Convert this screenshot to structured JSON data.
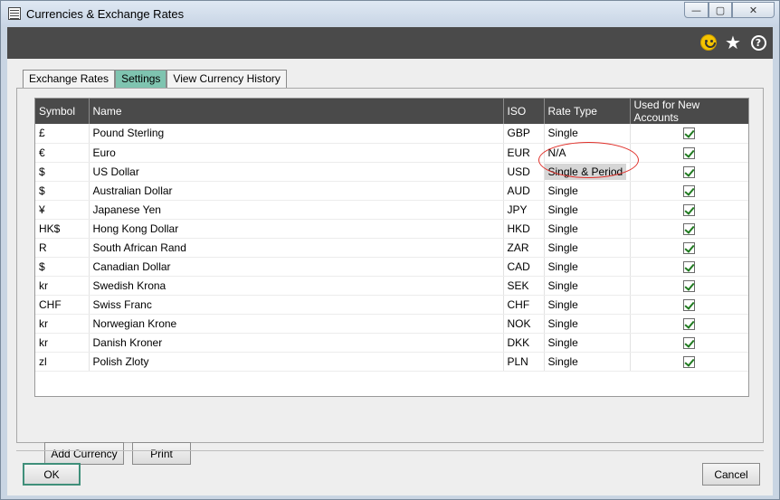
{
  "window": {
    "title": "Currencies & Exchange Rates",
    "minimize_glyph": "—",
    "maximize_glyph": "▢",
    "close_glyph": "✕"
  },
  "toolbar": {
    "icons": [
      "smiley-icon",
      "star-icon",
      "help-icon"
    ],
    "star_glyph": "★",
    "help_glyph": "?"
  },
  "tabs": [
    {
      "label": "Exchange Rates",
      "active": false
    },
    {
      "label": "Settings",
      "active": true
    },
    {
      "label": "View Currency History",
      "active": false
    }
  ],
  "grid": {
    "columns": [
      "Symbol",
      "Name",
      "ISO",
      "Rate Type",
      "Used for New Accounts"
    ],
    "rows": [
      {
        "symbol": "£",
        "name": "Pound Sterling",
        "iso": "GBP",
        "rate_type": "Single",
        "used": true
      },
      {
        "symbol": "€",
        "name": "Euro",
        "iso": "EUR",
        "rate_type": "N/A",
        "used": true
      },
      {
        "symbol": "$",
        "name": "US Dollar",
        "iso": "USD",
        "rate_type": "Single & Period",
        "used": true,
        "highlighted": true
      },
      {
        "symbol": "$",
        "name": "Australian Dollar",
        "iso": "AUD",
        "rate_type": "Single",
        "used": true
      },
      {
        "symbol": "¥",
        "name": "Japanese Yen",
        "iso": "JPY",
        "rate_type": "Single",
        "used": true
      },
      {
        "symbol": "HK$",
        "name": "Hong Kong Dollar",
        "iso": "HKD",
        "rate_type": "Single",
        "used": true
      },
      {
        "symbol": "R",
        "name": "South African Rand",
        "iso": "ZAR",
        "rate_type": "Single",
        "used": true
      },
      {
        "symbol": "$",
        "name": "Canadian Dollar",
        "iso": "CAD",
        "rate_type": "Single",
        "used": true
      },
      {
        "symbol": "kr",
        "name": "Swedish Krona",
        "iso": "SEK",
        "rate_type": "Single",
        "used": true
      },
      {
        "symbol": "CHF",
        "name": "Swiss Franc",
        "iso": "CHF",
        "rate_type": "Single",
        "used": true
      },
      {
        "symbol": "kr",
        "name": "Norwegian Krone",
        "iso": "NOK",
        "rate_type": "Single",
        "used": true
      },
      {
        "symbol": "kr",
        "name": "Danish Kroner",
        "iso": "DKK",
        "rate_type": "Single",
        "used": true
      },
      {
        "symbol": "zl",
        "name": "Polish Zloty",
        "iso": "PLN",
        "rate_type": "Single",
        "used": true
      }
    ]
  },
  "buttons": {
    "add_currency": "Add Currency",
    "print": "Print",
    "ok": "OK",
    "cancel": "Cancel"
  },
  "colors": {
    "active_tab": "#7fc4b0",
    "toolbar": "#4a4a4a",
    "annotation": "#e0302a"
  }
}
